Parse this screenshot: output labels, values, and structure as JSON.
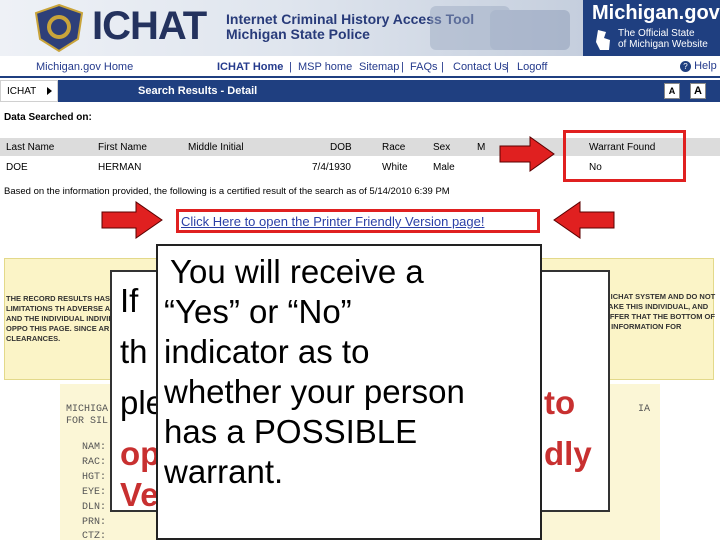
{
  "header": {
    "badge_text": "MICHIGAN STATE POLICE",
    "logo": "ICHAT",
    "tagline_line1": "Internet Criminal History Access Tool",
    "tagline_line2": "Michigan State Police",
    "site_title": "Michigan.gov",
    "site_sub1": "The Official State",
    "site_sub2": "of Michigan Website"
  },
  "nav": {
    "michigan_home": "Michigan.gov Home",
    "ichat_home": "ICHAT Home",
    "msp_home": "MSP home",
    "sitemap": "Sitemap",
    "faqs": "FAQs",
    "contact": "Contact Us",
    "logoff": "Logoff",
    "help": "Help",
    "sep": "|"
  },
  "subbar": {
    "breadcrumb": "ICHAT",
    "title": "Search Results - Detail",
    "font_small": "A",
    "font_large": "A"
  },
  "search": {
    "heading": "Data Searched on:",
    "columns": [
      "Last Name",
      "First Name",
      "Middle Initial",
      "DOB",
      "Race",
      "Sex",
      "M",
      "Warrant Found"
    ],
    "row": [
      "DOE",
      "HERMAN",
      "",
      "7/4/1930",
      "White",
      "Male",
      "",
      "No"
    ],
    "certified": "Based on the information provided, the following is a certified result of the search as of 5/14/2010 6:39 PM",
    "printer_link": "Click Here to open the Printer Friendly Version page!"
  },
  "disclaimer": {
    "left": "THE RECORD RESULTS HAS LIMITATIONS TH ADVERSE ACTION BAS AND THE INDIVIDUAL INDIVIDUAL THE OPPO THIS PAGE. SINCE AR FUTURE CLEARANCES.",
    "right": "F ICHAT SYSTEM AND DO NOT TAKE THIS INDIVIDUAL, AND OFFER THAT THE BOTTOM OF S INFORMATION FOR"
  },
  "record": {
    "line1": "MICHIGA",
    "line2": "FOR SIL",
    "line1_right": "IA",
    "fields": [
      "NAM:",
      "RAC:",
      "HGT:",
      "EYE:",
      "DLN:",
      "PRN:",
      "CTZ:"
    ]
  },
  "back_callout": {
    "w1": "If",
    "w2": "th",
    "w3": "ple",
    "w3_right": "to",
    "w4": "op",
    "w4_right": "dly",
    "w5": "Ve"
  },
  "callout": {
    "line1": "You will receive a",
    "line2": "“Yes” or “No”",
    "line3": "indicator as to",
    "line4": "whether your person",
    "line5": "has a POSSIBLE",
    "line6": "warrant."
  },
  "colors": {
    "accent_red": "#e02020",
    "nav_blue": "#1f3f80",
    "link_blue": "#2a3fa6",
    "disclaimer_yellow": "#fbf4c7"
  }
}
